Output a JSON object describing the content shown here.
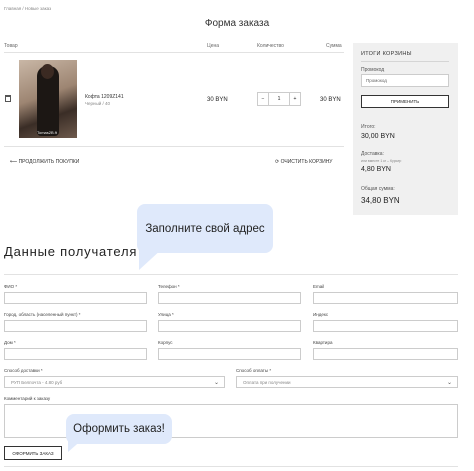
{
  "breadcrumb": "Главная / Новые заказ",
  "page_title": "Форма заказа",
  "table_headers": {
    "product": "Товар",
    "price": "Цена",
    "quantity": "Количество",
    "total": "Сумма"
  },
  "cart_item": {
    "name": "Кофта 1209Z141",
    "variant": "Черный / 40",
    "watermark": "Tomas2B.ft",
    "price": "30 BYN",
    "quantity": "1",
    "minus": "−",
    "plus": "+",
    "total": "30 BYN"
  },
  "continue_shopping": "ПРОДОЛЖИТЬ ПОКУПКИ",
  "clear_cart": "ОЧИСТИТЬ КОРЗИНУ",
  "summary": {
    "title": "ИТОГИ КОРЗИНЫ",
    "promo_label": "Промокод",
    "promo_placeholder": "Промокод",
    "apply_label": "ПРИМЕНИТЬ",
    "subtotal_label": "Итого:",
    "subtotal_value": "30,00 BYN",
    "delivery_label": "Доставка:",
    "delivery_note": "или вместе 1 кг – Курьер",
    "delivery_value": "4,80 BYN",
    "grand_total_label": "Общая сумма:",
    "grand_total_value": "34,80 BYN"
  },
  "bubble_address": "Заполните свой адрес",
  "bubble_order": "Оформить заказ!",
  "recipient_title": "Данные получателя",
  "form": {
    "fio_label": "ФИО *",
    "phone_label": "Телефон *",
    "email_label": "Email",
    "city_label": "Город, область (населенный пункт) *",
    "street_label": "Улица *",
    "zip_label": "Индекс",
    "house_label": "Дом *",
    "building_label": "Корпус",
    "apartment_label": "Квартира",
    "delivery_method_label": "Способ доставки *",
    "delivery_method_value": "РУП Белпочта - 4.80 руб",
    "payment_method_label": "Способ оплаты *",
    "payment_method_value": "Оплата при получении",
    "comment_label": "Комментарий к заказу"
  },
  "order_button": "ОФОРМИТЬ ЗАКАЗ"
}
